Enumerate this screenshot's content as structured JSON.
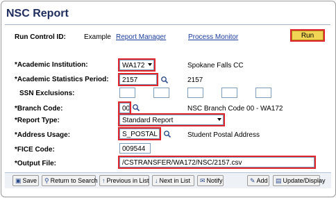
{
  "page": {
    "title": "NSC Report"
  },
  "run_control": {
    "label": "Run Control ID:",
    "value": "Example",
    "report_manager": "Report Manager",
    "process_monitor": "Process Monitor",
    "run_label": "Run"
  },
  "form": {
    "academic_institution": {
      "label": "*Academic Institution:",
      "value": "WA172",
      "description": "Spokane Falls CC"
    },
    "academic_statistics_period": {
      "label": "*Academic Statistics Period:",
      "value": "2157",
      "description": "2157"
    },
    "ssn_exclusions": {
      "label": "SSN Exclusions:"
    },
    "branch_code": {
      "label": "*Branch Code:",
      "value": "00",
      "description": "NSC Branch Code 00 - WA172"
    },
    "report_type": {
      "label": "*Report Type:",
      "value": "Standard Report"
    },
    "address_usage": {
      "label": "*Address Usage:",
      "value": "S_POSTAL",
      "description": "Student Postal Address"
    },
    "fice_code": {
      "label": "*FICE Code:",
      "value": "009544"
    },
    "output_file": {
      "label": "*Output File:",
      "value": "/CSTRANSFER/WA172/NSC/2157.csv"
    }
  },
  "toolbar": {
    "save": "Save",
    "return_to_search": "Return to Search",
    "previous_in_list": "Previous in List",
    "next_in_list": "Next in List",
    "notify": "Notify",
    "add": "Add",
    "update_display": "Update/Display"
  },
  "icons": {
    "lookup": "magnifier-icon",
    "dropdown": "chevron-down-icon"
  },
  "colors": {
    "highlight": "#e0242c",
    "title": "#1e2d5e",
    "link": "#1a3c9c",
    "run_button": "#f2d455"
  }
}
